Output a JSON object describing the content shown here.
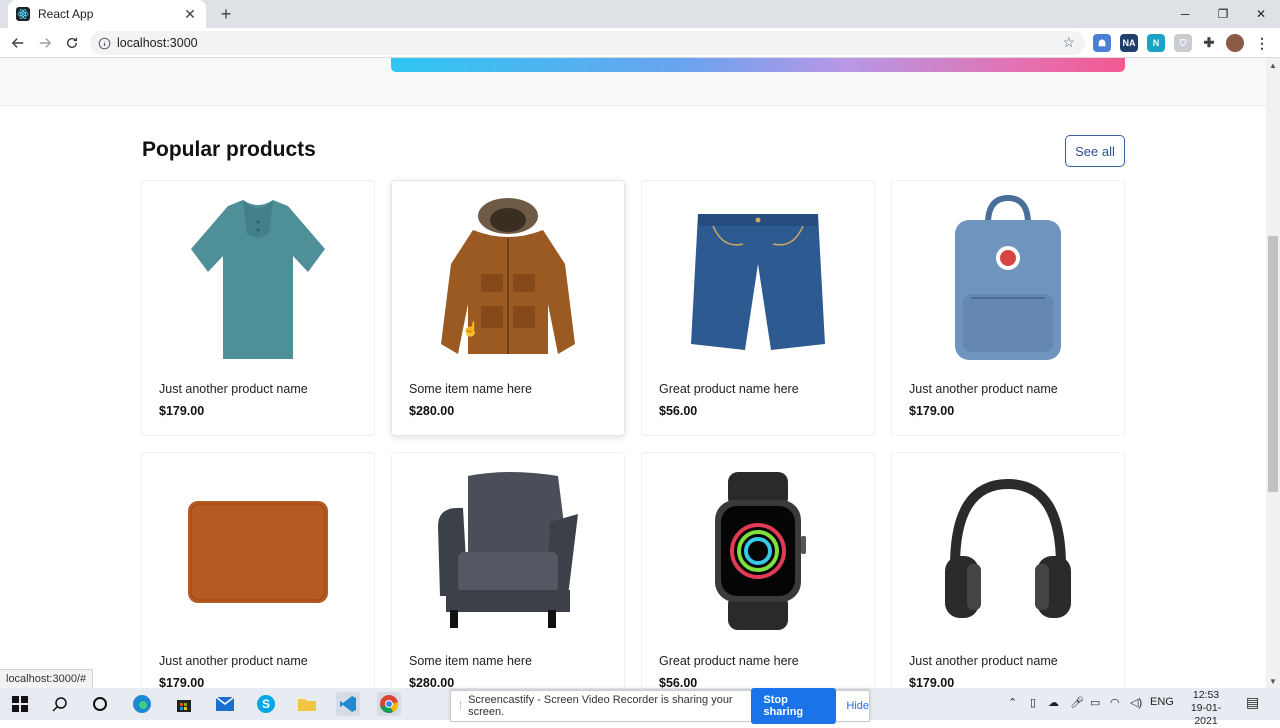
{
  "browser": {
    "tab_title": "React App",
    "url": "localhost:3000",
    "status_url": "localhost:3000/#"
  },
  "section": {
    "title": "Popular products",
    "see_all_label": "See all"
  },
  "products": [
    {
      "name": "Just another product name",
      "price": "$179.00",
      "icon": "polo-shirt-icon"
    },
    {
      "name": "Some item name here",
      "price": "$280.00",
      "icon": "jacket-icon"
    },
    {
      "name": "Great product name here",
      "price": "$56.00",
      "icon": "denim-shorts-icon"
    },
    {
      "name": "Just another product name",
      "price": "$179.00",
      "icon": "backpack-icon"
    },
    {
      "name": "Just another product name",
      "price": "$179.00",
      "icon": "laptop-sleeve-icon"
    },
    {
      "name": "Some item name here",
      "price": "$280.00",
      "icon": "armchair-icon"
    },
    {
      "name": "Great product name here",
      "price": "$56.00",
      "icon": "smartwatch-icon"
    },
    {
      "name": "Just another product name",
      "price": "$179.00",
      "icon": "headphones-icon"
    }
  ],
  "screencastify": {
    "message": "Screencastify - Screen Video Recorder is sharing your screen.",
    "stop_label": "Stop sharing",
    "hide_label": "Hide"
  },
  "taskbar": {
    "language": "ENG",
    "time": "12:53",
    "date": "19-01-2021"
  },
  "colors": {
    "accent": "#2d4f9a",
    "gradient": [
      "#2ec6f2",
      "#b898e6",
      "#f05a8f"
    ]
  }
}
